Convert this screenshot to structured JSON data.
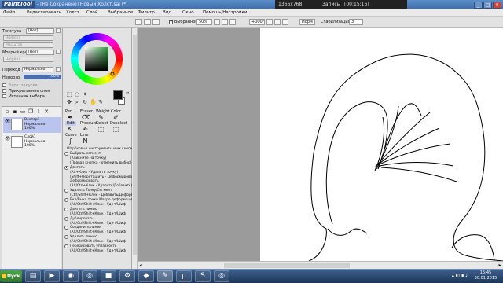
{
  "titlebar": {
    "logo": "PaintTool SAI",
    "title": "- [Не Сохранено] Новый Холст.sai (*)",
    "resolution": "1366x768",
    "record_label": "Запись",
    "record_time": "[00:15:16]",
    "window_buttons": [
      "_",
      "□",
      "×"
    ]
  },
  "menubar": {
    "items": [
      "Файл",
      "Редактировать",
      "Холст",
      "Слой",
      "Выбранное",
      "Фильтр",
      "Вид",
      "Окно",
      "Помощь/Настройки"
    ]
  },
  "toolbar": {
    "selection_checkbox_label": "Выбранное",
    "zoom_value": "50%",
    "rotation_value": "+000°",
    "mode_label": "Норм",
    "stabilizer_label": "Стабилизация",
    "stabilizer_value": "3"
  },
  "left_panel": {
    "texture_label": "Текстура",
    "texture_value": "[Нет]",
    "texture_sub1": "Эффект",
    "texture_sub2": "Масштаб",
    "wet_edge_label": "Мокрый край",
    "wet_edge_value": "[Нет]",
    "wet_edge_sub": "Ширина",
    "blend_label": "Переход",
    "blend_value": "Нормально",
    "opacity_label": "Непрозр.",
    "opacity_value": "100%",
    "option_guard": "Блок. запуска",
    "option_clip": "Прикрепление слоя",
    "option_source": "Источник выбора"
  },
  "layers": [
    {
      "name": "Вектор1",
      "mode": "Нормально",
      "opacity": "100%",
      "active": true
    },
    {
      "name": "Слой1",
      "mode": "Нормально",
      "opacity": "100%",
      "active": false
    }
  ],
  "tools": {
    "tabs_row1": [
      "Pen",
      "Eraser",
      "Weight",
      "Color"
    ],
    "tabs_row2": [
      "Edit",
      "Pressure",
      "Select",
      "Deselect"
    ],
    "tabs_row3": [
      "Curve",
      "Line"
    ],
    "hints_title": "Штрбховые инструменты и их кнопки",
    "hints": [
      {
        "text": "Выбрать сегмент",
        "radio": true,
        "on": false
      },
      {
        "text": "(Кликните на точку)",
        "radio": false
      },
      {
        "text": "(Правая кнопка - отменить выбор)",
        "radio": false
      },
      {
        "text": "Двигать",
        "radio": true,
        "on": true
      },
      {
        "text": "(Alt+Клик - Удалить точку)",
        "radio": false
      },
      {
        "text": "(Shift+Перетащить - Деформировать",
        "radio": false
      },
      {
        "text": "Деформировать",
        "radio": false
      },
      {
        "text": "(Alt/Ctrl+Клик - Удалить/Добавить)",
        "radio": false
      },
      {
        "text": "Удалить Точку/Сегмент",
        "radio": true,
        "on": false
      },
      {
        "text": "(Ctrl/Shift+Клик - Добавить/Деформи",
        "radio": false
      },
      {
        "text": "Вкл/Выкл точки Макро деформации",
        "radio": true,
        "on": false
      },
      {
        "text": "(Alt/Ctrl/Shift+Клик - Уд+т/Шиф",
        "radio": false
      },
      {
        "text": "Двигать линию",
        "radio": true,
        "on": false
      },
      {
        "text": "(Alt/Ctrl/Shift+Клик - Уд+т/Шиф",
        "radio": false
      },
      {
        "text": "Дублировать",
        "radio": true,
        "on": false
      },
      {
        "text": "(Alt/Ctrl/Shift+Клик - Уд+т/Шиф",
        "radio": false
      },
      {
        "text": "Соединить линии",
        "radio": true,
        "on": false
      },
      {
        "text": "(Alt/Ctrl/Shift+Клик - Уд+т/Шиф",
        "radio": false
      },
      {
        "text": "Удалить линию",
        "radio": true,
        "on": false
      },
      {
        "text": "(Alt/Ctrl/Shift+Клик - Уд+т/Шиф",
        "radio": false
      },
      {
        "text": "Перерисовать уплавность",
        "radio": true,
        "on": false
      },
      {
        "text": "(Alt/Ctrl/Shift+Клик - Уд+т/Шиф",
        "radio": false
      }
    ]
  },
  "colors": {
    "primary": "#000000",
    "secondary": "#ffffff"
  },
  "taskbar": {
    "start_label": "Пуск",
    "apps": [
      "folder",
      "media",
      "firefox",
      "chrome",
      "minecraft",
      "gear",
      "paint",
      "utorrent",
      "skype",
      "chrome2"
    ],
    "time": "15:45",
    "date": "30.01.2015"
  }
}
